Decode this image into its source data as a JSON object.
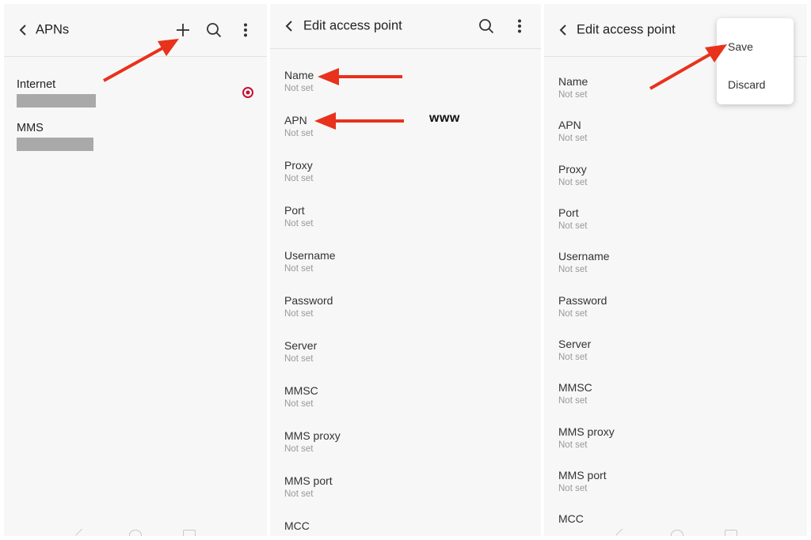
{
  "panel1": {
    "title": "APNs",
    "apns": [
      {
        "name": "Internet",
        "selected": true
      },
      {
        "name": "MMS",
        "selected": false
      }
    ],
    "icons": [
      "back-arrow-icon",
      "plus-icon",
      "search-icon",
      "more-vert-icon"
    ]
  },
  "panel2": {
    "title": "Edit access point",
    "fields": [
      {
        "label": "Name",
        "value": "Not set"
      },
      {
        "label": "APN",
        "value": "Not set"
      },
      {
        "label": "Proxy",
        "value": "Not set"
      },
      {
        "label": "Port",
        "value": "Not set"
      },
      {
        "label": "Username",
        "value": "Not set"
      },
      {
        "label": "Password",
        "value": "Not set"
      },
      {
        "label": "Server",
        "value": "Not set"
      },
      {
        "label": "MMSC",
        "value": "Not set"
      },
      {
        "label": "MMS proxy",
        "value": "Not set"
      },
      {
        "label": "MMS port",
        "value": "Not set"
      },
      {
        "label": "MCC",
        "value": ""
      }
    ],
    "icons": [
      "back-arrow-icon",
      "search-icon",
      "more-vert-icon"
    ]
  },
  "panel3": {
    "title": "Edit access point",
    "fields": [
      {
        "label": "Name",
        "value": "Not set"
      },
      {
        "label": "APN",
        "value": "Not set"
      },
      {
        "label": "Proxy",
        "value": "Not set"
      },
      {
        "label": "Port",
        "value": "Not set"
      },
      {
        "label": "Username",
        "value": "Not set"
      },
      {
        "label": "Password",
        "value": "Not set"
      },
      {
        "label": "Server",
        "value": "Not set"
      },
      {
        "label": "MMSC",
        "value": "Not set"
      },
      {
        "label": "MMS proxy",
        "value": "Not set"
      },
      {
        "label": "MMS port",
        "value": "Not set"
      },
      {
        "label": "MCC",
        "value": ""
      }
    ],
    "menu": {
      "save": "Save",
      "discard": "Discard"
    }
  },
  "annotation": {
    "apn_text": "www"
  },
  "colors": {
    "arrow": "#e8321c",
    "radio": "#c8102e",
    "redacted": "#a9a9a9"
  }
}
